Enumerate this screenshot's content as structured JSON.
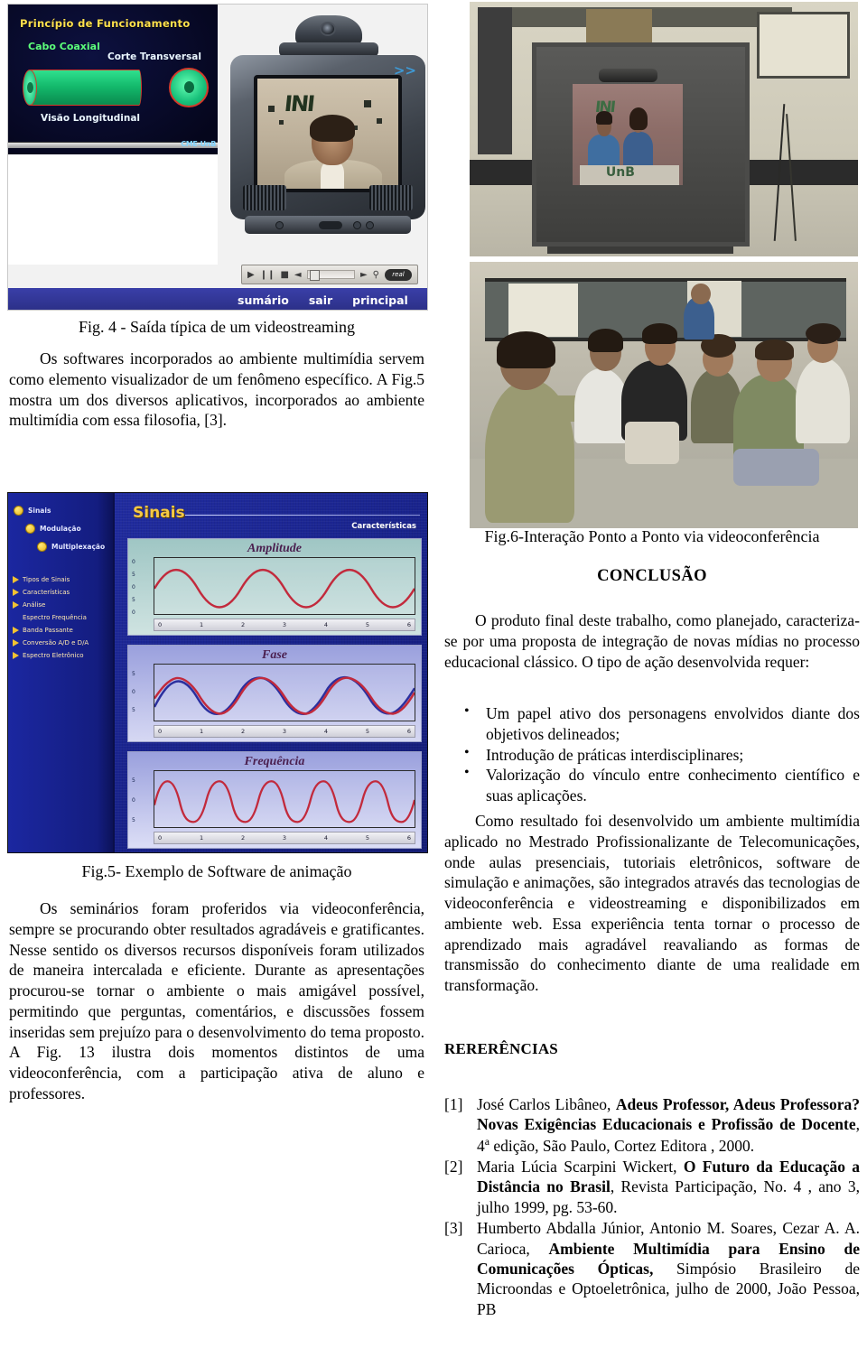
{
  "figures": {
    "fig4": {
      "caption": "Fig. 4 - Saída típica de um videostreaming",
      "animation": {
        "title": "Princípio de Funcionamento",
        "subtitle_cable": "Cabo Coaxial",
        "label_cross": "Corte Transversal",
        "label_long": "Visão Longitudinal",
        "logo": "CME-UnB"
      },
      "player": {
        "play": "▶",
        "pause": "❙❙",
        "stop": "■",
        "prev": "◄",
        "next": "►",
        "mute": "🔊",
        "brand": "real"
      },
      "nav": [
        "sumário",
        "sair",
        "principal"
      ]
    },
    "fig5": {
      "caption": "Fig.5- Exemplo de Software de animação",
      "header_title": "Sinais",
      "header_sub": "Características",
      "menu_tree": [
        "Sinais",
        "Modulação",
        "Multiplexação"
      ],
      "menu_list": [
        "Tipos de Sinais",
        "Características",
        "Análise",
        "Espectro Frequência",
        "Banda Passante",
        "Conversão A/D e D/A",
        "Espectro Eletrônico"
      ],
      "plots": [
        {
          "title": "Amplitude",
          "xticks": [
            "0",
            "1",
            "2",
            "3",
            "4",
            "5",
            "6"
          ],
          "yticks": [
            "0",
            "5",
            "0",
            "5",
            "0"
          ]
        },
        {
          "title": "Fase",
          "xticks": [
            "0",
            "1",
            "2",
            "3",
            "4",
            "5",
            "6"
          ],
          "yticks": [
            "5",
            "0",
            "5"
          ]
        },
        {
          "title": "Frequência",
          "xticks": [
            "0",
            "1",
            "2",
            "3",
            "4",
            "5",
            "6"
          ],
          "yticks": [
            "5",
            "0",
            "5"
          ]
        }
      ]
    },
    "fig6": {
      "caption": "Fig.6-Interação Ponto a Ponto via videoconferência",
      "screen_logo": "UnB"
    }
  },
  "body": {
    "para1": "Os softwares incorporados ao ambiente multimídia servem como elemento visualizador de um fenômeno específico. A Fig.5 mostra um dos diversos aplicativos, incorporados ao ambiente multimídia com essa filosofia, [3].",
    "para2": "Os seminários foram proferidos via videoconferência, sempre se procurando obter resultados agradáveis e gratificantes. Nesse sentido os diversos recursos disponíveis foram utilizados de maneira intercalada e eficiente. Durante as apresentações procurou-se tornar o ambiente o mais amigável possível, permitindo que perguntas, comentários, e discussões fossem inseridas sem prejuízo para o desenvolvimento do tema proposto. A Fig. 13 ilustra dois momentos distintos de uma videoconferência, com a participação ativa de aluno e professores.",
    "conclusion_heading": "CONCLUSÃO",
    "para3": "O produto final deste trabalho, como planejado, caracteriza-se por uma proposta de integração de novas mídias no processo educacional clássico. O tipo de ação desenvolvida requer:",
    "bullets": [
      "Um papel ativo dos personagens envolvidos diante dos objetivos delineados;",
      "Introdução de práticas interdisciplinares;",
      "Valorização do vínculo entre conhecimento científico e suas aplicações."
    ],
    "para4": "Como resultado foi desenvolvido um ambiente multimídia aplicado no Mestrado Profissionalizante de Telecomunicações, onde aulas presenciais, tutoriais eletrônicos, software de simulação e animações, são integrados através das tecnologias de videoconferência e videostreaming e disponibilizados em ambiente web. Essa experiência tenta tornar o processo de aprendizado mais agradável reavaliando as formas de transmissão do conhecimento diante de uma realidade em transformação.",
    "references_heading": "RERERÊNCIAS",
    "references": [
      {
        "tag": "[1]",
        "pre": "José Carlos Libâneo, ",
        "bold": "Adeus Professor, Adeus Professora? Novas Exigências Educacionais e Profissão de Docente",
        "post_a": ", 4",
        "sup": "a",
        "post_b": " edição, São Paulo, Cortez Editora , 2000."
      },
      {
        "tag": "[2]",
        "pre": "Maria Lúcia Scarpini Wickert, ",
        "bold": "O Futuro da Educação a Distância no Brasil",
        "post_a": ", Revista Participação, No. 4 , ano 3, julho 1999, pg. 53-60.",
        "sup": "",
        "post_b": ""
      },
      {
        "tag": "[3]",
        "pre": "Humberto Abdalla Júnior, Antonio M. Soares, Cezar A. A. Carioca, ",
        "bold": "Ambiente Multimídia para Ensino de Comunicações Ópticas,",
        "post_a": " Simpósio Brasileiro de Microondas e Optoeletrônica, julho de 2000, João Pessoa, PB",
        "sup": "",
        "post_b": ""
      }
    ]
  }
}
